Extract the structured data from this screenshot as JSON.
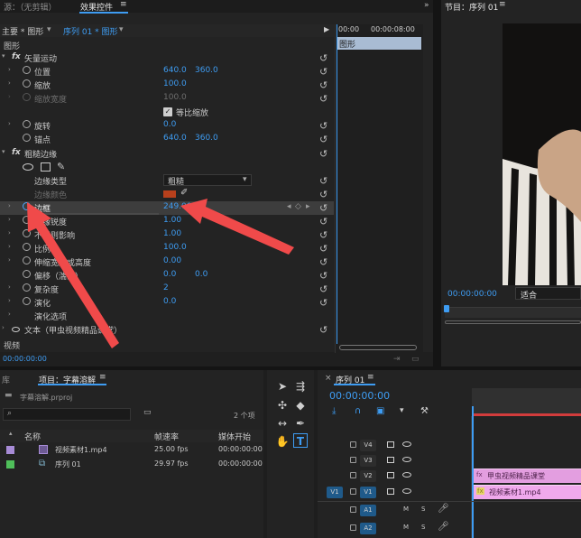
{
  "source_panel": {
    "tab": "源：（无剪辑）"
  },
  "effect_controls": {
    "tab": "效果控件",
    "master": "主要 * 图形",
    "sequence": "序列 01 * 图形",
    "section_label": "图形",
    "vector_motion": "矢量运动",
    "props_motion": [
      {
        "label": "位置",
        "v1": "640.0",
        "v2": "360.0"
      },
      {
        "label": "缩放",
        "v1": "100.0"
      },
      {
        "label": "缩放宽度",
        "v1": "100.0"
      },
      {
        "label": "等比缩放"
      },
      {
        "label": "旋转",
        "v1": "0.0"
      },
      {
        "label": "锚点",
        "v1": "640.0",
        "v2": "360.0"
      }
    ],
    "brush_edge": "粗糙边缘",
    "edge_type_label": "边缘类型",
    "edge_type_value": "粗糙",
    "edge_color_label": "边缘颜色",
    "border_label": "边框",
    "border_value": "249.00",
    "props_edge": [
      {
        "label": "边缘锐度",
        "v1": "1.00"
      },
      {
        "label": "不规则影响",
        "v1": "1.00"
      },
      {
        "label": "比例",
        "v1": "100.0"
      },
      {
        "label": "伸缩宽度或高度",
        "v1": "0.00"
      },
      {
        "label": "偏移（湍流）",
        "v1": "0.0",
        "v2": "0.0"
      },
      {
        "label": "复杂度",
        "v1": "2"
      },
      {
        "label": "演化",
        "v1": "0.0"
      },
      {
        "label": "演化选项"
      }
    ],
    "text_layer": "文本（甲虫视频精品课堂）",
    "video_label": "视频",
    "timecode": "00:00:00:00",
    "mini_time_start": "00:00",
    "mini_time_end": "00:00:08:00",
    "mini_clip": "图形"
  },
  "program": {
    "tab": "节目：序列 01",
    "timecode": "00:00:00:00",
    "fit": "适合"
  },
  "project": {
    "lib_tab": "库",
    "tab": "项目：字幕溶解",
    "file": "字幕溶解.prproj",
    "item_count": "2 个项",
    "columns": [
      "名称",
      "帧速率",
      "媒体开始"
    ],
    "items": [
      {
        "name": "视频素材1.mp4",
        "fps": "25.00 fps",
        "start": "00:00:00:00",
        "color": "#a78bd6"
      },
      {
        "name": "序列 01",
        "fps": "29.97 fps",
        "start": "00:00:00:00",
        "color": "#4fbf5a"
      }
    ]
  },
  "timeline": {
    "tab": "序列 01",
    "timecode": "00:00:00:00",
    "tracks": [
      {
        "name": "V4"
      },
      {
        "name": "V3"
      },
      {
        "name": "V2"
      },
      {
        "name": "V1",
        "src": "V1"
      },
      {
        "name": "A1"
      },
      {
        "name": "A2"
      }
    ],
    "clip_title": "甲虫视频精品课堂",
    "clip_video": "视频素材1.mp4"
  },
  "colors": {
    "accent": "#3e9cf2",
    "clip_pink": "#e39ee0",
    "arrow": "#f04a4a",
    "edge_swatch": "#b8401c"
  }
}
